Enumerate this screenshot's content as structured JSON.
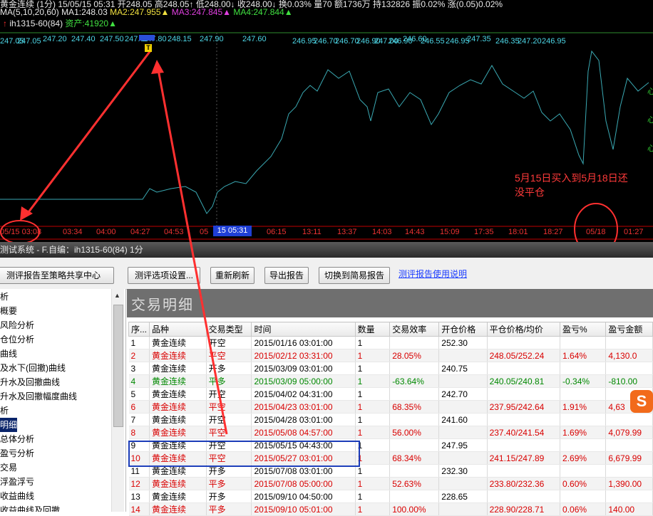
{
  "chart": {
    "header_line1": "黄金连续 (1分)  15/05/15 05:31 开248.05 高248.05↑ 低248.00↓ 收248.00↓ 换0.03% 量70 额1736万 持132826 振0.02% 涨(0.05)0.02%",
    "ma_line": {
      "label": "MA(5,10,20,60)",
      "ma1": "MA1:248.03",
      "ma2": "MA2:247.955▲",
      "ma3": "MA3:247.845▲",
      "ma4": "MA4:247.844▲"
    },
    "indicator_line": {
      "name": "ih1315-60(84)",
      "asset": "资产:41920▲"
    },
    "price_labels": [
      "247.05",
      "247.05",
      "247.20",
      "247.40",
      "247.50",
      "247.60",
      "247.80",
      "248.15",
      "247.90",
      "247.60",
      "246.95",
      "246.70",
      "246.70",
      "246.90",
      "247.00",
      "246.90",
      "246.60",
      "246.55",
      "246.95",
      "247.35",
      "246.35",
      "247.20",
      "246.95"
    ],
    "marker_label": "T",
    "right_labels": [
      "心",
      "心",
      "心"
    ],
    "time_axis": [
      "05/15 03:08",
      "03:34",
      "04:00",
      "04:27",
      "04:53",
      "05",
      "15 05:31",
      "7",
      "06:15",
      "13:11",
      "13:37",
      "14:03",
      "14:43",
      "15:09",
      "17:35",
      "18:01",
      "18:27",
      "05/18",
      "01:27"
    ],
    "annotation": {
      "line1": "5月15日买入到5月18日还",
      "line2": "没平仓"
    },
    "colors": {
      "background": "#000000",
      "price_line": "#3aa9b3",
      "price_label": "#4dd6e6",
      "grid": "#c00000",
      "annotation": "#ff3a3a"
    }
  },
  "status_bar": {
    "text": "测试系统 - F.自编：ih1315-60(84) 1分"
  },
  "toolbar": {
    "share_button": "测评报告至策略共享中心",
    "options_button": "测评选项设置...",
    "refresh_button": "重新刷新",
    "export_button": "导出报告",
    "simple_button": "切换到简易报告",
    "help_link": "测评报告使用说明"
  },
  "tree": {
    "items": [
      "析",
      "概要",
      "风险分析",
      "仓位分析",
      "曲线",
      "及水下(回撤)曲线",
      "升水及回撤曲线",
      "升水及回撤幅度曲线",
      "析",
      "明细",
      "总体分析",
      "盈亏分析",
      "交易",
      "浮盈浮亏",
      "收益曲线",
      "收益曲线及回撤"
    ],
    "selected_index": 9
  },
  "panel": {
    "title": "交易明细",
    "columns": [
      "序...",
      "品种",
      "交易类型",
      "时间",
      "数量",
      "交易效率",
      "开仓价格",
      "平仓价格/均价",
      "盈亏%",
      "盈亏金额"
    ],
    "rows": [
      {
        "no": "1",
        "symbol": "黄金连续",
        "type": "开空",
        "time": "2015/01/16 03:01:00",
        "qty": "1",
        "eff": "",
        "open": "252.30",
        "close": "",
        "pct": "",
        "pnl": "",
        "color": "black"
      },
      {
        "no": "2",
        "symbol": "黄金连续",
        "type": "平空",
        "time": "2015/02/12 03:31:00",
        "qty": "1",
        "eff": "28.05%",
        "open": "",
        "close": "248.05/252.24",
        "pct": "1.64%",
        "pnl": "4,130.0",
        "color": "red"
      },
      {
        "no": "3",
        "symbol": "黄金连续",
        "type": "开多",
        "time": "2015/03/09 03:01:00",
        "qty": "1",
        "eff": "",
        "open": "240.75",
        "close": "",
        "pct": "",
        "pnl": "",
        "color": "black"
      },
      {
        "no": "4",
        "symbol": "黄金连续",
        "type": "平多",
        "time": "2015/03/09 05:00:00",
        "qty": "1",
        "eff": "-63.64%",
        "open": "",
        "close": "240.05/240.81",
        "pct": "-0.34%",
        "pnl": "-810.00",
        "color": "green"
      },
      {
        "no": "5",
        "symbol": "黄金连续",
        "type": "开空",
        "time": "2015/04/02 04:31:00",
        "qty": "1",
        "eff": "",
        "open": "242.70",
        "close": "",
        "pct": "",
        "pnl": "",
        "color": "black"
      },
      {
        "no": "6",
        "symbol": "黄金连续",
        "type": "平空",
        "time": "2015/04/23 03:01:00",
        "qty": "1",
        "eff": "68.35%",
        "open": "",
        "close": "237.95/242.64",
        "pct": "1.91%",
        "pnl": "4,63",
        "color": "red"
      },
      {
        "no": "7",
        "symbol": "黄金连续",
        "type": "开空",
        "time": "2015/04/28 03:01:00",
        "qty": "1",
        "eff": "",
        "open": "241.60",
        "close": "",
        "pct": "",
        "pnl": "",
        "color": "black"
      },
      {
        "no": "8",
        "symbol": "黄金连续",
        "type": "平空",
        "time": "2015/05/08 04:57:00",
        "qty": "1",
        "eff": "56.00%",
        "open": "",
        "close": "237.40/241.54",
        "pct": "1.69%",
        "pnl": "4,079.99",
        "color": "red"
      },
      {
        "no": "9",
        "symbol": "黄金连续",
        "type": "开空",
        "time": "2015/05/15 04:43:00",
        "qty": "1",
        "eff": "",
        "open": "247.95",
        "close": "",
        "pct": "",
        "pnl": "",
        "color": "black"
      },
      {
        "no": "10",
        "symbol": "黄金连续",
        "type": "平空",
        "time": "2015/05/27 03:01:00",
        "qty": "1",
        "eff": "68.34%",
        "open": "",
        "close": "241.15/247.89",
        "pct": "2.69%",
        "pnl": "6,679.99",
        "color": "red"
      },
      {
        "no": "11",
        "symbol": "黄金连续",
        "type": "开多",
        "time": "2015/07/08 03:01:00",
        "qty": "1",
        "eff": "",
        "open": "232.30",
        "close": "",
        "pct": "",
        "pnl": "",
        "color": "black"
      },
      {
        "no": "12",
        "symbol": "黄金连续",
        "type": "平多",
        "time": "2015/07/08 05:00:00",
        "qty": "1",
        "eff": "52.63%",
        "open": "",
        "close": "233.80/232.36",
        "pct": "0.60%",
        "pnl": "1,390.00",
        "color": "red"
      },
      {
        "no": "13",
        "symbol": "黄金连续",
        "type": "开多",
        "time": "2015/09/10 04:50:00",
        "qty": "1",
        "eff": "",
        "open": "228.65",
        "close": "",
        "pct": "",
        "pnl": "",
        "color": "black"
      },
      {
        "no": "14",
        "symbol": "黄金连续",
        "type": "平多",
        "time": "2015/09/10 05:01:00",
        "qty": "1",
        "eff": "100.00%",
        "open": "",
        "close": "228.90/228.71",
        "pct": "0.06%",
        "pnl": "140.00",
        "color": "red"
      }
    ]
  },
  "sogou_badge": "S"
}
